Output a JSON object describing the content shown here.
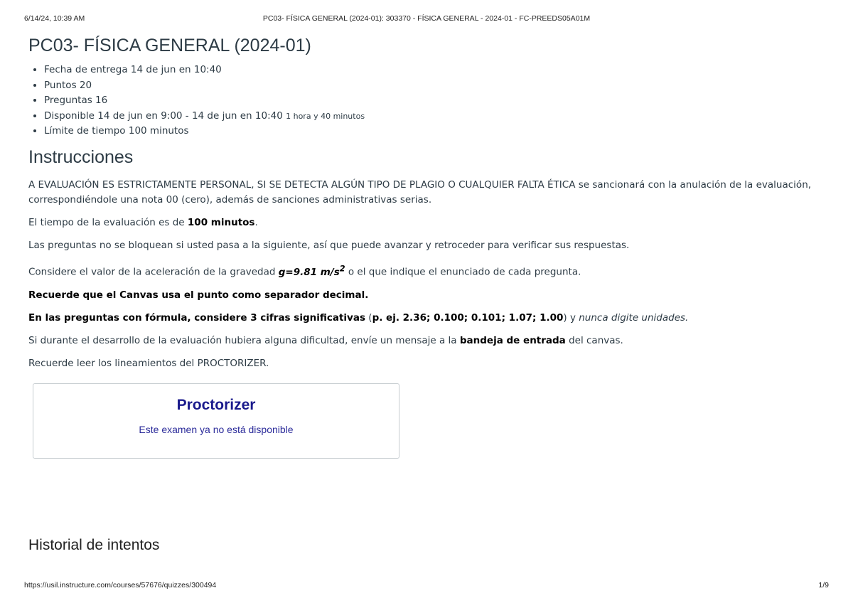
{
  "print_header": {
    "datetime": "6/14/24, 10:39 AM",
    "doc_title": "PC03- FÍSICA GENERAL (2024-01): 303370 - FÍSICA GENERAL - 2024-01 - FC-PREEDS05A01M"
  },
  "quiz": {
    "title": "PC03- FÍSICA GENERAL (2024-01)",
    "details": [
      {
        "label": "Fecha de entrega",
        "value": "14 de jun en 10:40"
      },
      {
        "label": "Puntos",
        "value": "20"
      },
      {
        "label": "Preguntas",
        "value": "16"
      },
      {
        "label": "Disponible",
        "value": "14 de jun en 9:00 - 14 de jun en 10:40",
        "extra": "1 hora y 40 minutos"
      },
      {
        "label": "Límite de tiempo",
        "value": "100 minutos"
      }
    ]
  },
  "instructions": {
    "heading": "Instrucciones",
    "p1": "A EVALUACIÓN ES ESTRICTAMENTE PERSONAL, SI SE DETECTA ALGÚN TIPO DE PLAGIO O CUALQUIER FALTA ÉTICA se sancionará con la anulación de la evaluación, correspondiéndole una nota 00 (cero), además de sanciones administrativas serias.",
    "p2_pre": "El tiempo de la evaluación es de ",
    "p2_bold": "100 minutos",
    "p2_post": ".",
    "p3": "Las preguntas no se bloquean si usted pasa a la siguiente, así que puede avanzar y retroceder para verificar sus respuestas.",
    "p4_pre": "Considere el valor de la aceleración de la gravedad ",
    "p4_formula": "g=9.81 m/s",
    "p4_sup": "2",
    "p4_post": " o el que indique el enunciado de cada pregunta.",
    "p5": "Recuerde que el Canvas usa el punto como separador decimal.",
    "p6_bold": "En las preguntas con fórmula, considere 3 cifras significativas",
    "p6_open": " (",
    "p6_examples": "p. ej. 2.36; 0.100; 0.101; 1.07; 1.00",
    "p6_close": ") y ",
    "p6_italic": "nunca digite unidades.",
    "p7_pre": "Si durante el desarrollo de la evaluación hubiera alguna dificultad, envíe un mensaje a la ",
    "p7_bold": "bandeja de entrada",
    "p7_post": " del canvas.",
    "p8": "Recuerde leer los lineamientos del PROCTORIZER."
  },
  "proctorizer": {
    "title": "Proctorizer",
    "message": "Este examen ya no está disponible"
  },
  "history": {
    "heading": "Historial de intentos"
  },
  "print_footer": {
    "url": "https://usil.instructure.com/courses/57676/quizzes/300494",
    "page": "1/9"
  }
}
